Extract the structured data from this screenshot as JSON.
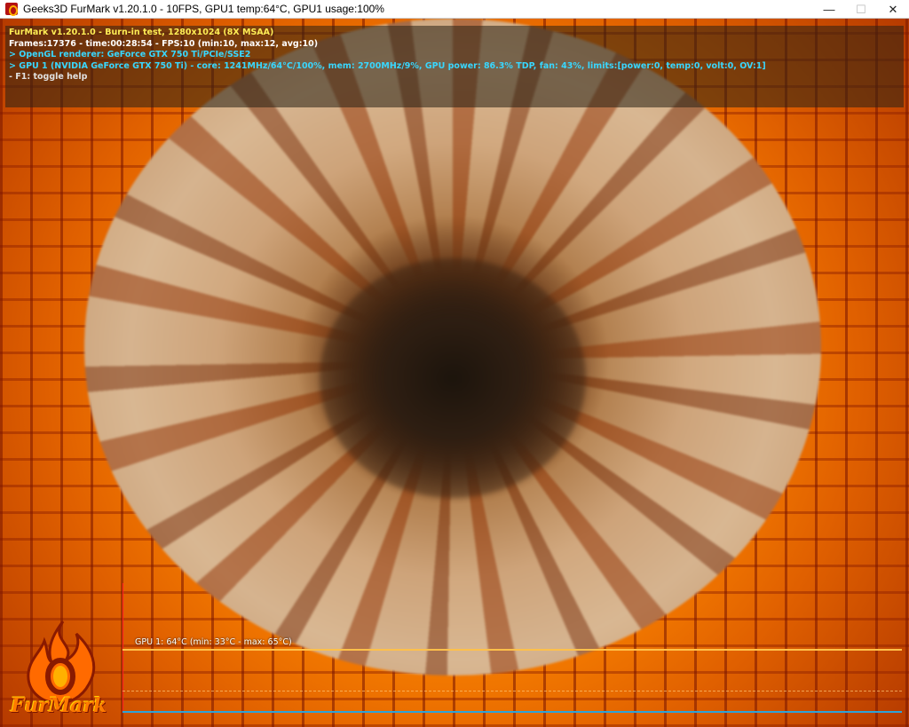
{
  "window": {
    "title": "Geeks3D FurMark v1.20.1.0 - 10FPS, GPU1 temp:64°C, GPU1 usage:100%",
    "icon": "furmark-app-icon",
    "controls": {
      "minimize": "—",
      "maximize": "☐",
      "close": "✕"
    }
  },
  "osd": {
    "lines": [
      "FurMark v1.20.1.0 - Burn-in test, 1280x1024 (8X MSAA)",
      "Frames:17376 - time:00:28:54 - FPS:10 (min:10, max:12, avg:10)",
      "> OpenGL renderer: GeForce GTX 750 Ti/PCIe/SSE2",
      "> GPU 1 (NVIDIA GeForce GTX 750 Ti) - core: 1241MHz/64°C/100%, mem: 2700MHz/9%, GPU power: 86.3% TDP, fan: 43%, limits:[power:0, temp:0, volt:0, OV:1]",
      "- F1: toggle help"
    ]
  },
  "graph": {
    "label": "GPU 1: 64°C (min: 33°C - max: 65°C)",
    "colors": {
      "axis_y": "#ff2020",
      "axis_x": "#2ea3d8",
      "line": "#ffc04a"
    }
  },
  "logo": {
    "text": "FurMark",
    "icon": "flame-icon"
  }
}
